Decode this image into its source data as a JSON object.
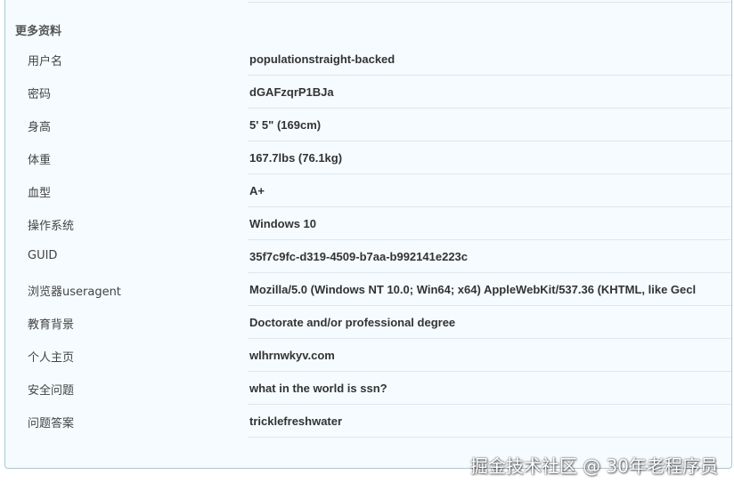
{
  "section": {
    "title": "更多资料"
  },
  "rows": [
    {
      "label": "用户名",
      "value": "populationstraight-backed"
    },
    {
      "label": "密码",
      "value": "dGAFzqrP1BJa"
    },
    {
      "label": "身高",
      "value": "5' 5\" (169cm)"
    },
    {
      "label": "体重",
      "value": "167.7lbs (76.1kg)"
    },
    {
      "label": "血型",
      "value": "A+"
    },
    {
      "label": "操作系统",
      "value": "Windows 10"
    },
    {
      "label": "GUID",
      "value": "35f7c9fc-d319-4509-b7aa-b992141e223c"
    },
    {
      "label": "浏览器useragent",
      "value": "Mozilla/5.0 (Windows NT 10.0; Win64; x64) AppleWebKit/537.36 (KHTML, like Gecl"
    },
    {
      "label": "教育背景",
      "value": "Doctorate and/or professional degree"
    },
    {
      "label": "个人主页",
      "value": "wlhrnwkyv.com"
    },
    {
      "label": "安全问题",
      "value": "what in the world is ssn?"
    },
    {
      "label": "问题答案",
      "value": "tricklefreshwater"
    }
  ],
  "watermark": "掘金技术社区 @ 30年老程序员"
}
